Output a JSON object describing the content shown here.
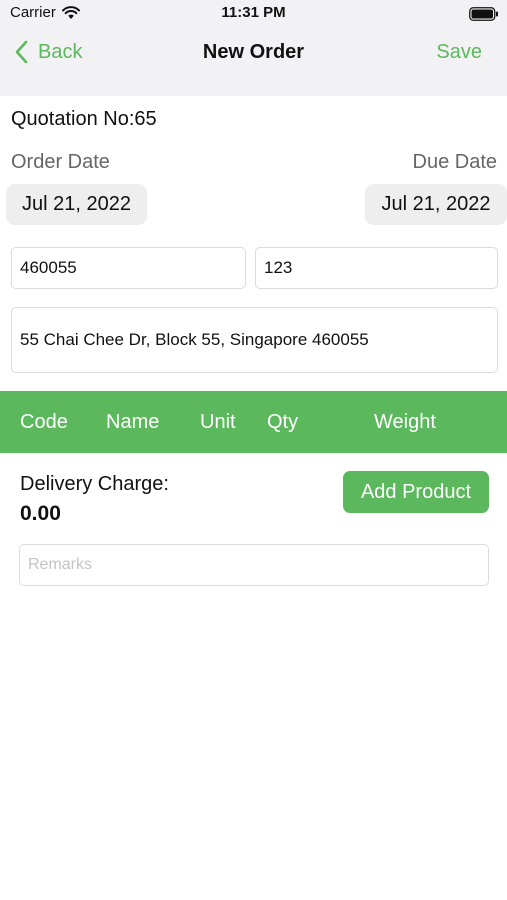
{
  "status_bar": {
    "carrier": "Carrier",
    "time": "11:31 PM",
    "wifi_icon": "wifi-icon",
    "battery_icon": "battery-icon"
  },
  "nav": {
    "back_label": "Back",
    "title": "New Order",
    "save_label": "Save",
    "accent_color": "#5cb85c"
  },
  "order": {
    "quotation_label": "Quotation No:65",
    "order_date_label": "Order Date",
    "due_date_label": "Due Date",
    "order_date": "Jul 21, 2022",
    "due_date": "Jul 21, 2022",
    "postal_code": "460055",
    "unit_number": "123",
    "address": "55 Chai Chee Dr, Block 55,  Singapore 460055"
  },
  "table": {
    "columns": [
      "Code",
      "Name",
      "Unit",
      "Qty",
      "Weight"
    ],
    "header_color": "#5cb85c"
  },
  "delivery": {
    "label": "Delivery Charge:",
    "value": "0.00"
  },
  "add_product_label": "Add Product",
  "remarks": {
    "placeholder": "Remarks",
    "value": ""
  }
}
